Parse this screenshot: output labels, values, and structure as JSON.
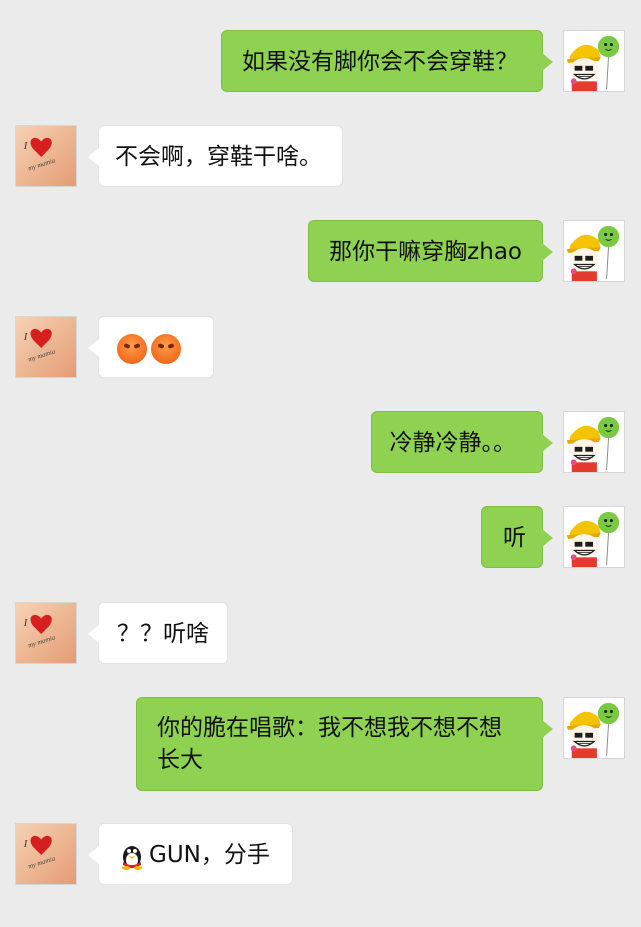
{
  "messages": [
    {
      "sender": "me",
      "text": "如果没有脚你会不会穿鞋？"
    },
    {
      "sender": "them",
      "text": "不会啊，穿鞋干啥。"
    },
    {
      "sender": "me",
      "text": "那你干嘛穿胸zhao"
    },
    {
      "sender": "them",
      "emoji": [
        "angry-face-icon",
        "angry-face-icon"
      ]
    },
    {
      "sender": "me",
      "text": "冷静冷静。。"
    },
    {
      "sender": "me",
      "text": "听"
    },
    {
      "sender": "them",
      "text": "？？听啥"
    },
    {
      "sender": "me",
      "text_line1": "你的脆在唱歌：我不想我不想不想",
      "text_line2": "长大"
    },
    {
      "sender": "them",
      "icon": "qq-penguin-icon",
      "text": "GUN，分手"
    }
  ],
  "avatars": {
    "me": "boy-with-balloon-avatar",
    "them": "heart-arm-avatar",
    "them_caption_1": "I",
    "them_caption_2": "my mamia"
  },
  "colors": {
    "background": "#ebebeb",
    "my_bubble": "#8fd150",
    "their_bubble": "#ffffff"
  }
}
